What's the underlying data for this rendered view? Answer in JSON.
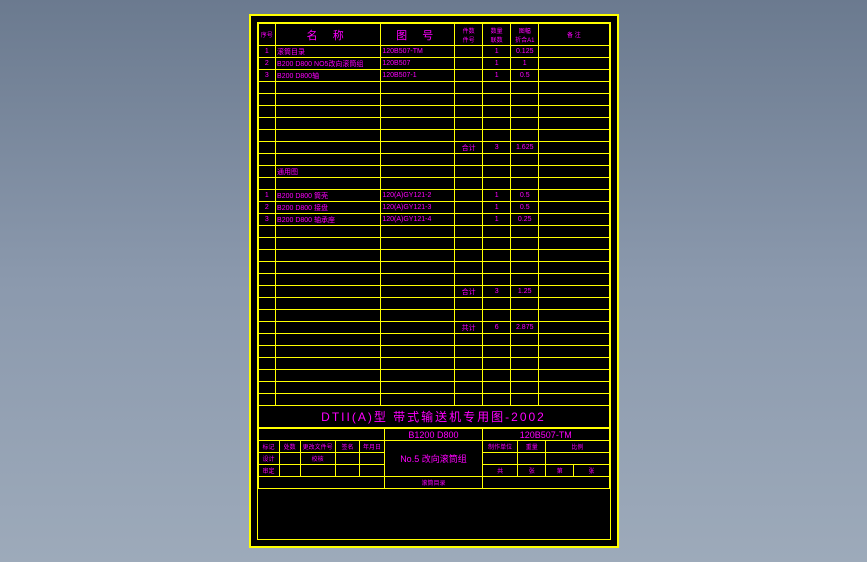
{
  "header": {
    "seq": "序号",
    "name": "名 称",
    "drawing": "图 号",
    "col4a": "件数",
    "col4b": "件号",
    "col5a": "数量",
    "col5b": "联数",
    "col6a": "图幅",
    "col6b": "折合A1",
    "col7": "备 注"
  },
  "rows1": [
    {
      "n": "1",
      "name": "滚筒目录",
      "dwg": "120B507-TM",
      "a": "",
      "b": "1",
      "c": "0.125",
      "d": ""
    },
    {
      "n": "2",
      "name": "B200 D800 NO5改向滚筒组",
      "dwg": "120B507",
      "a": "",
      "b": "1",
      "c": "1",
      "d": ""
    },
    {
      "n": "3",
      "name": "B200 D800轴",
      "dwg": "120B507-1",
      "a": "",
      "b": "1",
      "c": "0.5",
      "d": ""
    }
  ],
  "sum1": {
    "label": "合计",
    "b": "3",
    "c": "1.625"
  },
  "subhead": "通用图",
  "rows2": [
    {
      "n": "1",
      "name": "B200 D800 筒壳",
      "dwg": "120(A)GY121-2",
      "a": "",
      "b": "1",
      "c": "0.5",
      "d": ""
    },
    {
      "n": "2",
      "name": "B200 D800 接盘",
      "dwg": "120(A)GY121-3",
      "a": "",
      "b": "1",
      "c": "0.5",
      "d": ""
    },
    {
      "n": "3",
      "name": "B200 D800 轴承座",
      "dwg": "120(A)GY121-4",
      "a": "",
      "b": "1",
      "c": "0.25",
      "d": ""
    }
  ],
  "sum2": {
    "label": "合计",
    "b": "3",
    "c": "1.25"
  },
  "total": {
    "label": "共计",
    "b": "6",
    "c": "2.875"
  },
  "titleblock": {
    "title": "DTII(A)型 带式输送机专用图-2002",
    "model": "B1200 D800",
    "code": "120B507-TM",
    "part": "No.5 改向滚筒组",
    "footer_label": "滚筒目录",
    "f1": "标记",
    "f2": "处数",
    "f3": "更改文件号",
    "f4": "签名",
    "f5": "年月日",
    "g1": "设计",
    "g2": "校核",
    "g3": "审定",
    "h1": "制作单位",
    "h2": "重量",
    "h3": "比例",
    "h4": "共",
    "h5": "张",
    "h6": "第",
    "h7": "张"
  }
}
